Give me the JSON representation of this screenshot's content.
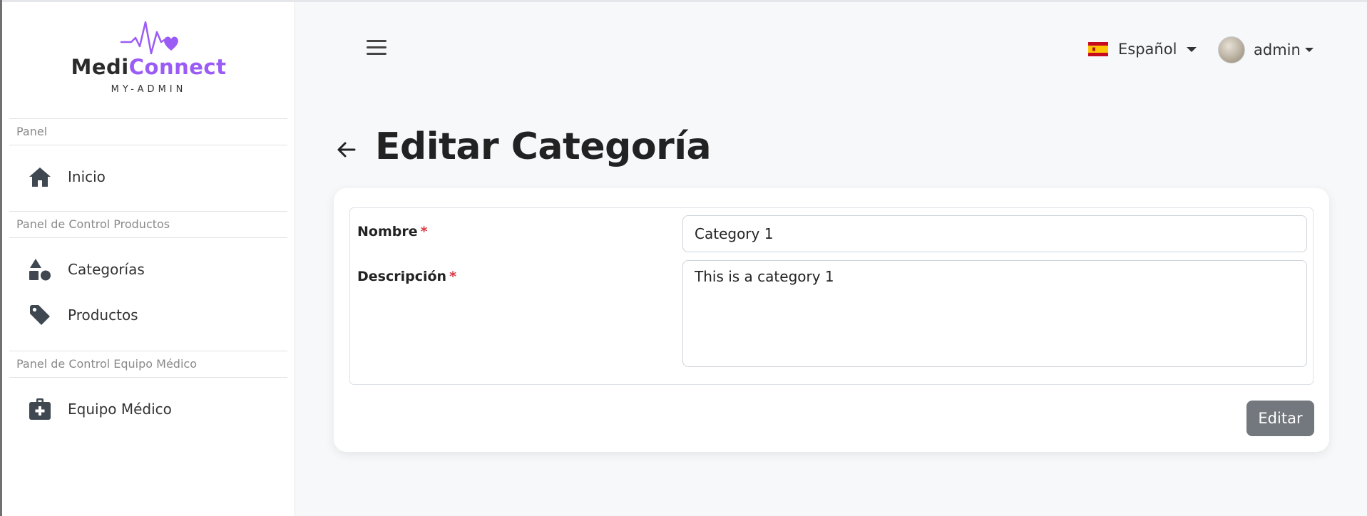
{
  "brand": {
    "name_part1": "Medi",
    "name_part2": "Connect",
    "subtitle": "MY-ADMIN",
    "accent_color": "#9b5cf5"
  },
  "sidebar": {
    "sections": [
      {
        "label": "Panel"
      },
      {
        "label": "Panel de Control Productos"
      },
      {
        "label": "Panel de Control Equipo Médico"
      }
    ],
    "items": [
      {
        "label": "Inicio",
        "icon": "home-icon"
      },
      {
        "label": "Categorías",
        "icon": "shapes-icon"
      },
      {
        "label": "Productos",
        "icon": "tag-icon"
      },
      {
        "label": "Equipo Médico",
        "icon": "medical-kit-icon"
      }
    ]
  },
  "header": {
    "language": {
      "label": "Español",
      "flag": "spain-flag-icon"
    },
    "user": {
      "label": "admin"
    }
  },
  "page": {
    "title": "Editar Categoría"
  },
  "form": {
    "fields": [
      {
        "label": "Nombre",
        "required": "*",
        "value": "Category 1"
      },
      {
        "label": "Descripción",
        "required": "*",
        "value": "This is a category 1"
      }
    ],
    "submit_label": "Editar"
  }
}
